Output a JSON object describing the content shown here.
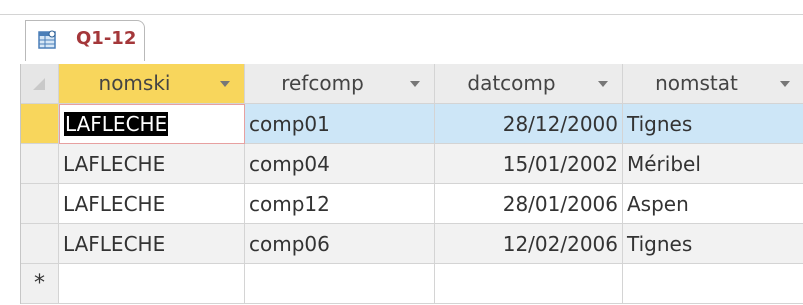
{
  "tab": {
    "title": "Q1-12",
    "icon": "query-table-icon"
  },
  "columns": [
    {
      "label": "nomski",
      "icon": "chevron-down-icon"
    },
    {
      "label": "refcomp",
      "icon": "chevron-down-icon"
    },
    {
      "label": "datcomp",
      "icon": "chevron-down-icon"
    },
    {
      "label": "nomstat",
      "icon": "chevron-down-icon"
    }
  ],
  "rows": [
    {
      "nomski": "LAFLECHE",
      "refcomp": "comp01",
      "datcomp": "28/12/2000",
      "nomstat": "Tignes"
    },
    {
      "nomski": "LAFLECHE",
      "refcomp": "comp04",
      "datcomp": "15/01/2002",
      "nomstat": "Méribel"
    },
    {
      "nomski": "LAFLECHE",
      "refcomp": "comp12",
      "datcomp": "28/01/2006",
      "nomstat": "Aspen"
    },
    {
      "nomski": "LAFLECHE",
      "refcomp": "comp06",
      "datcomp": "12/02/2006",
      "nomstat": "Tignes"
    }
  ],
  "new_record_marker": "*",
  "colors": {
    "tab_title": "#a4373a",
    "selected_row": "#cde6f7",
    "selector_highlight": "#f8d65c",
    "alt_row": "#f2f2f2"
  }
}
